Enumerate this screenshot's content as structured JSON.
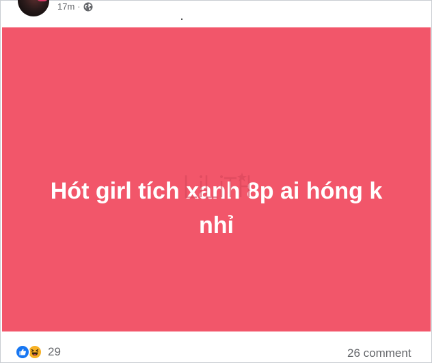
{
  "post": {
    "timestamp": "17m",
    "separator": "·",
    "audience_icon": "globe-icon",
    "text_lines": [
      "Hót girl tích xanh 8p ai hóng k",
      "nhỉ"
    ],
    "background_color": "#f2566a",
    "watermark": "lilith"
  },
  "footer": {
    "reaction_icons": [
      "like-icon",
      "haha-icon"
    ],
    "reaction_count": "29",
    "comments_label": "26 comment"
  }
}
